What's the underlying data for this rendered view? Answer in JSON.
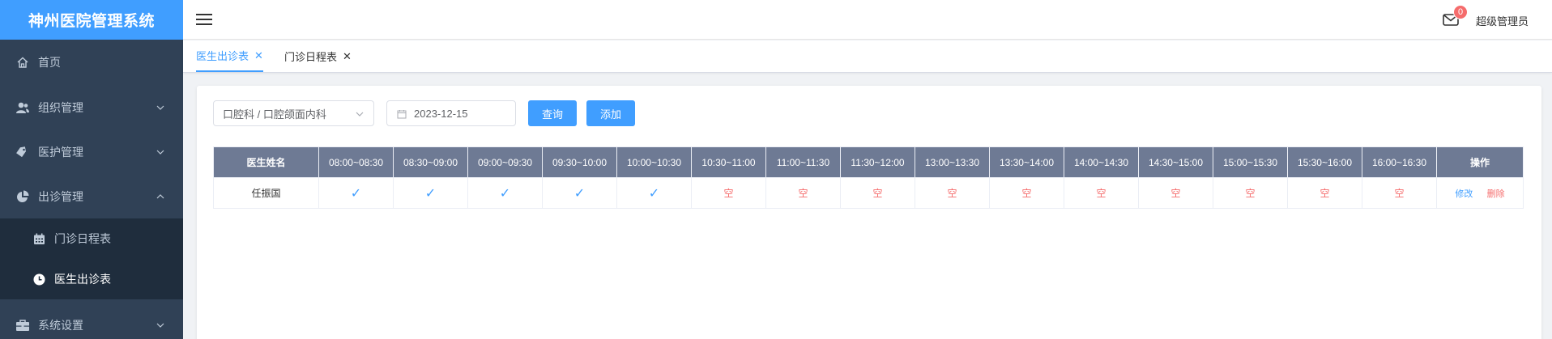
{
  "app": {
    "title": "神州医院管理系统"
  },
  "sidebar": {
    "items": [
      {
        "label": "首页",
        "icon": "home-icon"
      },
      {
        "label": "组织管理",
        "icon": "users-icon",
        "arrow": "down"
      },
      {
        "label": "医护管理",
        "icon": "tag-icon",
        "arrow": "down"
      },
      {
        "label": "出诊管理",
        "icon": "pie-chart-icon",
        "arrow": "up"
      },
      {
        "label": "系统设置",
        "icon": "briefcase-icon",
        "arrow": "down"
      }
    ],
    "submenu": [
      {
        "label": "门诊日程表",
        "icon": "calendar-icon"
      },
      {
        "label": "医生出诊表",
        "icon": "clock-icon",
        "active": true
      }
    ]
  },
  "header": {
    "user": "超级管理员",
    "badge_count": "0"
  },
  "tabs": [
    {
      "label": "医生出诊表",
      "active": true
    },
    {
      "label": "门诊日程表",
      "active": false
    }
  ],
  "filters": {
    "department": "口腔科 / 口腔颌面内科",
    "date": "2023-12-15",
    "query_button": "查询",
    "add_button": "添加"
  },
  "table": {
    "headers": [
      "医生姓名",
      "08:00~08:30",
      "08:30~09:00",
      "09:00~09:30",
      "09:30~10:00",
      "10:00~10:30",
      "10:30~11:00",
      "11:00~11:30",
      "11:30~12:00",
      "13:00~13:30",
      "13:30~14:00",
      "14:00~14:30",
      "14:30~15:00",
      "15:00~15:30",
      "15:30~16:00",
      "16:00~16:30",
      "操作"
    ],
    "rows": [
      {
        "name": "任振国",
        "slots": [
          "✓",
          "✓",
          "✓",
          "✓",
          "✓",
          "空",
          "空",
          "空",
          "空",
          "空",
          "空",
          "空",
          "空",
          "空",
          "空"
        ],
        "edit": "修改",
        "delete": "删除"
      }
    ]
  },
  "colors": {
    "sidebar_bg": "#304156",
    "accent": "#409eff",
    "header_row": "#6e7a94",
    "danger": "#f56c6c"
  }
}
